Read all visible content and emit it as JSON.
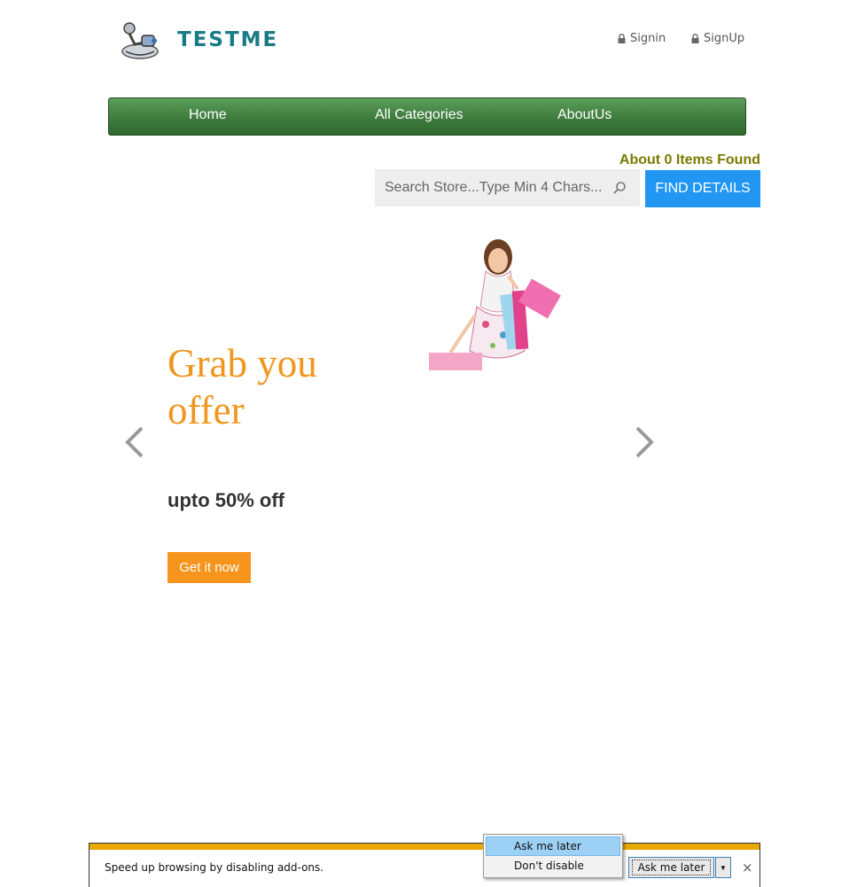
{
  "header": {
    "logo_text": "TESTME",
    "signin_label": "Signin",
    "signup_label": "SignUp"
  },
  "nav": {
    "items": [
      {
        "label": "Home"
      },
      {
        "label": "All Categories"
      },
      {
        "label": "AboutUs"
      }
    ],
    "color": "#3e7b3d"
  },
  "search": {
    "results_text": "About 0 Items Found",
    "placeholder": "Search Store...Type Min 4 Chars...",
    "value": "",
    "button_label": "FIND DETAILS",
    "button_color": "#2196f3"
  },
  "carousel": {
    "headline": "Grab you offer",
    "subline": "upto 50% off",
    "cta_label": "Get it now",
    "accent_color": "#f0961e",
    "icons": [
      "chevron-left-icon",
      "chevron-right-icon"
    ]
  },
  "notification": {
    "message": "Speed up browsing by disabling add-ons.",
    "primary_button": "Ask me later",
    "close_glyph": "×",
    "accent_color": "#e8a800",
    "menu": {
      "items": [
        {
          "label": "Ask me later"
        },
        {
          "label": "Don't disable"
        }
      ]
    }
  }
}
